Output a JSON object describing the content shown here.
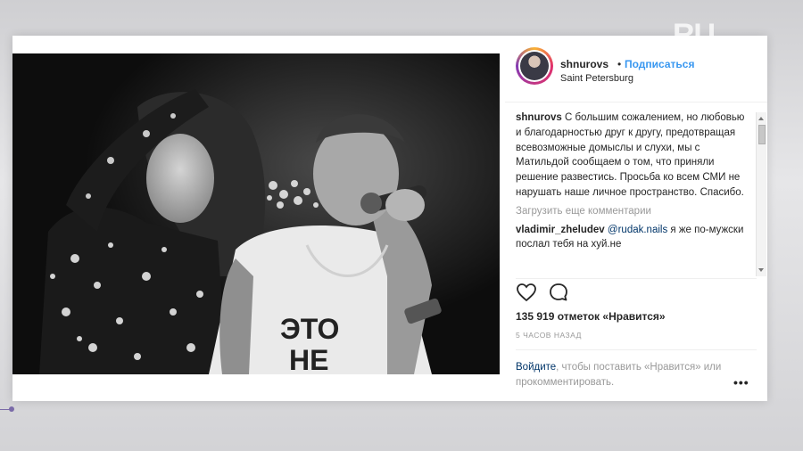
{
  "post": {
    "username": "shnurovs",
    "separator": "•",
    "follow_label": "Подписаться",
    "location": "Saint Petersburg",
    "caption": {
      "user": "shnurovs",
      "text": " С большим сожалением, но любовью и благодарностью друг к другу, предотвращая всевозможные домыслы и слухи, мы с Матильдой сообщаем о том, что приняли решение развестись. Просьба ко всем СМИ не нарушать наше личное пространство. Спасибо."
    },
    "load_more_label": "Загрузить еще комментарии",
    "comments": [
      {
        "user": "vladimir_zheludev",
        "mention": "@rudak.nails",
        "text": " я же по-мужски послал тебя на хуй.не"
      }
    ],
    "likes_text": "135 919 отметок «Нравится»",
    "time_ago": "5 ЧАСОВ НАЗАД",
    "login_link": "Войдите",
    "login_rest": ", чтобы поставить «Нравится» или прокомментировать.",
    "more_options": "•••"
  },
  "icons": {
    "like": "heart-icon",
    "comment": "comment-icon",
    "scroll_up": "chevron-up-icon",
    "scroll_down": "chevron-down-icon",
    "more": "more-options-icon"
  },
  "colors": {
    "link_blue": "#3897f0",
    "text_dark": "#262626",
    "text_muted": "#999999",
    "mention": "#003569"
  },
  "watermark": "RU"
}
